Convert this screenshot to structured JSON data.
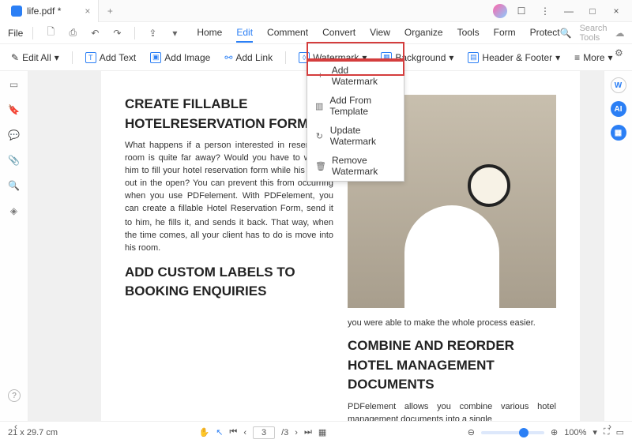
{
  "titlebar": {
    "tab_title": "life.pdf *"
  },
  "menubar": {
    "file": "File",
    "tabs": [
      "Home",
      "Edit",
      "Comment",
      "Convert",
      "View",
      "Organize",
      "Tools",
      "Form",
      "Protect"
    ],
    "search_placeholder": "Search Tools"
  },
  "toolbar": {
    "edit_all": "Edit All",
    "add_text": "Add Text",
    "add_image": "Add Image",
    "add_link": "Add Link",
    "watermark": "Watermark",
    "background": "Background",
    "header_footer": "Header & Footer",
    "more": "More"
  },
  "watermark_menu": {
    "add": "Add Watermark",
    "add_template": "Add From Template",
    "update": "Update Watermark",
    "remove": "Remove Watermark"
  },
  "doc": {
    "h1": "CREATE FILLABLE HOTELRESERVATION FORM",
    "p1": "What happens if a person interested in reserving a room is quite far away? Would you have to wait for him to fill your hotel reservation form while his load is out in the open? You can prevent this from occurring when you use PDFelement. With PDFelement, you can create a fillable Hotel Reservation Form, send it",
    "p1b": "to him, he fills it, and sends it back. That way, when the time comes, all your client has to do is move into his room.",
    "h2": "ADD CUSTOM LABELS TO BOOKING ENQUIRIES",
    "p2": "you were able to make the whole process easier.",
    "h3": "COMBINE AND REORDER HOTEL MANAGEMENT DOCUMENTS",
    "p3": "PDFelement allows you combine various hotel management documents into a single"
  },
  "status": {
    "page_size": "21 x 29.7 cm",
    "page_num": "3",
    "page_total": "/3",
    "zoom": "100%"
  }
}
